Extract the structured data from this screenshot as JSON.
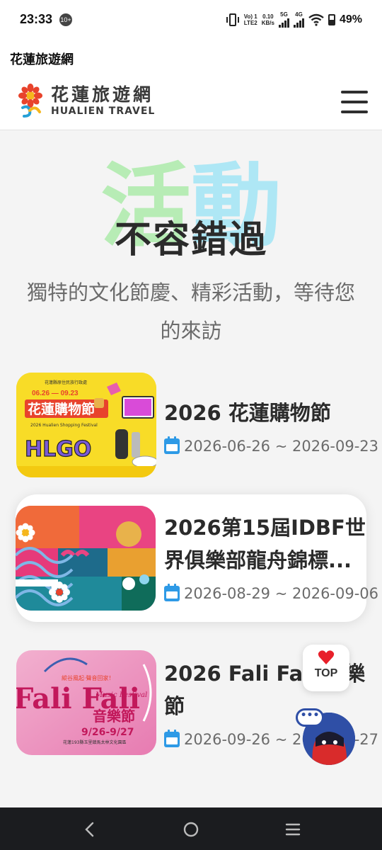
{
  "status_bar": {
    "time": "23:33",
    "notification_badge": "10+",
    "volte_top": "Vo) 1",
    "volte_bottom": "LTE2",
    "speed_top": "0.10",
    "speed_bottom": "KB/s",
    "net1": "5G",
    "net2": "4G",
    "battery": "49%"
  },
  "app_bar": {
    "title": "花蓮旅遊網"
  },
  "header": {
    "logo_zh": "花蓮旅遊網",
    "logo_en": "HUALIEN TRAVEL"
  },
  "hero": {
    "bg_char_1": "活",
    "bg_char_2": "動",
    "title": "不容錯過",
    "subtitle": "獨特的文化節慶、精彩活動，等待您的來訪"
  },
  "events": [
    {
      "title": "2026 花蓮購物節",
      "date": "2026-06-26 ~ 2026-09-23"
    },
    {
      "title": "2026第15屆IDBF世界俱樂部龍舟錦標...",
      "date": "2026-08-29 ~ 2026-09-06"
    },
    {
      "title": "2026 Fali Fali 音樂節",
      "date": "2026-09-26 ~ 2026-09-27"
    }
  ],
  "thumb1": {
    "org": "花蓮縣原住民族行政處",
    "dates": "06.26 — 09.23",
    "name": "花蓮購物節",
    "en": "2026 Hualien Shopping Festival",
    "word": "HLGO"
  },
  "thumb3": {
    "tag": "縱谷風起·聲音回家！",
    "name": "Fali Fali",
    "music": "Music Festival",
    "zh": "音樂節",
    "dates": "9/26-9/27",
    "venue": "花蓮193縣玉里鎮馬太林文化園區"
  },
  "floating": {
    "top_label": "TOP",
    "chat_dots": "•••"
  },
  "colors": {
    "accent_blue": "#2e9ae6",
    "hero_green": "#b7ecb5",
    "hero_cyan": "#aee7f5"
  }
}
